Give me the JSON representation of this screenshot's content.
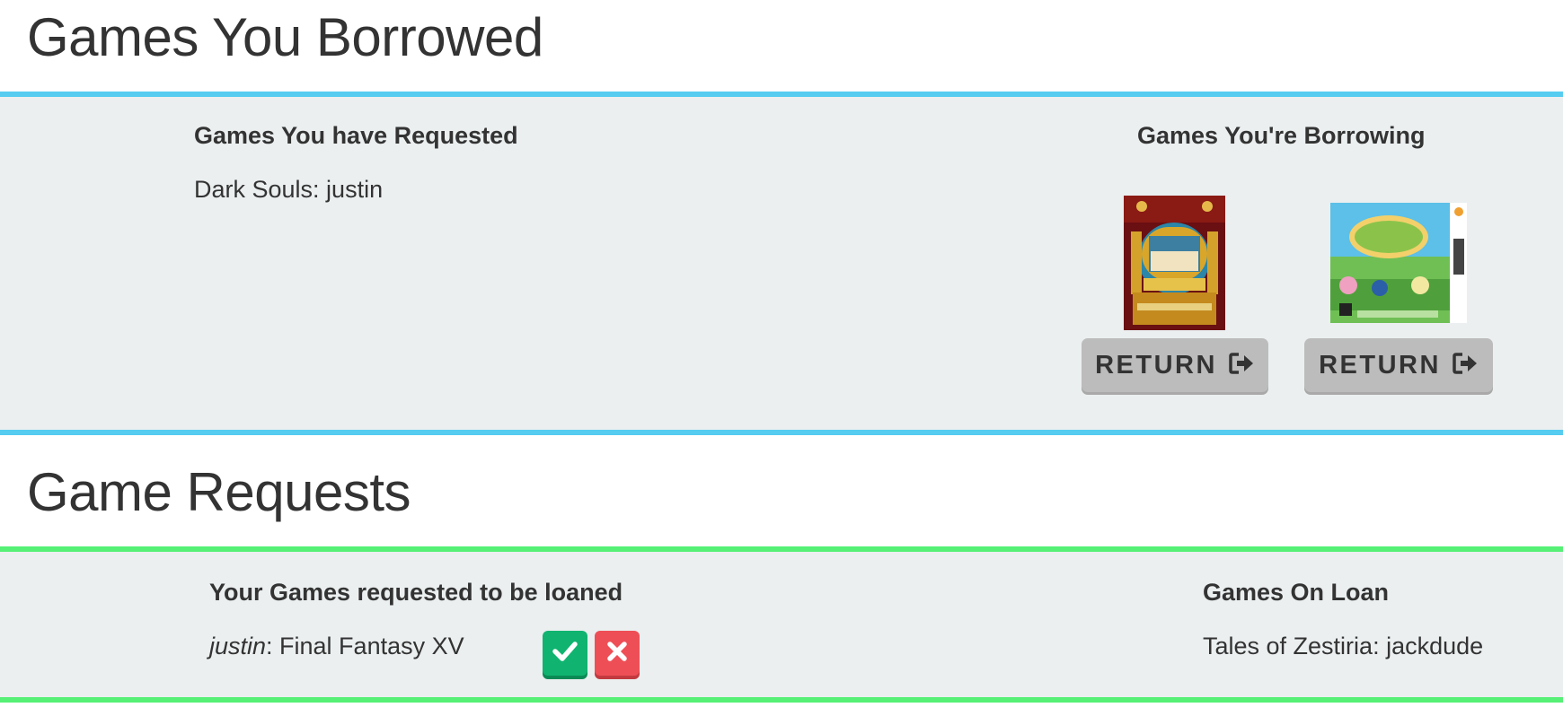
{
  "borrowed": {
    "title": "Games You Borrowed",
    "requested": {
      "heading": "Games You have Requested",
      "items": [
        "Dark Souls: justin"
      ]
    },
    "borrowing": {
      "heading": "Games You're Borrowing",
      "games": [
        {
          "cover": "theatrhythm-final-fantasy-cover",
          "return_label": "RETURN"
        },
        {
          "cover": "animal-crossing-new-leaf-3ds-cover",
          "return_label": "RETURN"
        }
      ]
    }
  },
  "requests": {
    "title": "Game Requests",
    "incoming": {
      "heading": "Your Games requested to be loaned",
      "items": [
        {
          "user": "justin",
          "game": ": Final Fantasy XV"
        }
      ]
    },
    "on_loan": {
      "heading": "Games On Loan",
      "items": [
        "Tales of Zestiria: jackdude"
      ]
    }
  },
  "colors": {
    "borrowed_border": "#55ccf0",
    "requests_border": "#55f075",
    "panel_bg": "#ebeff0",
    "accept": "#10b470",
    "decline": "#ee4f56",
    "button_gray": "#bcbcbc"
  }
}
